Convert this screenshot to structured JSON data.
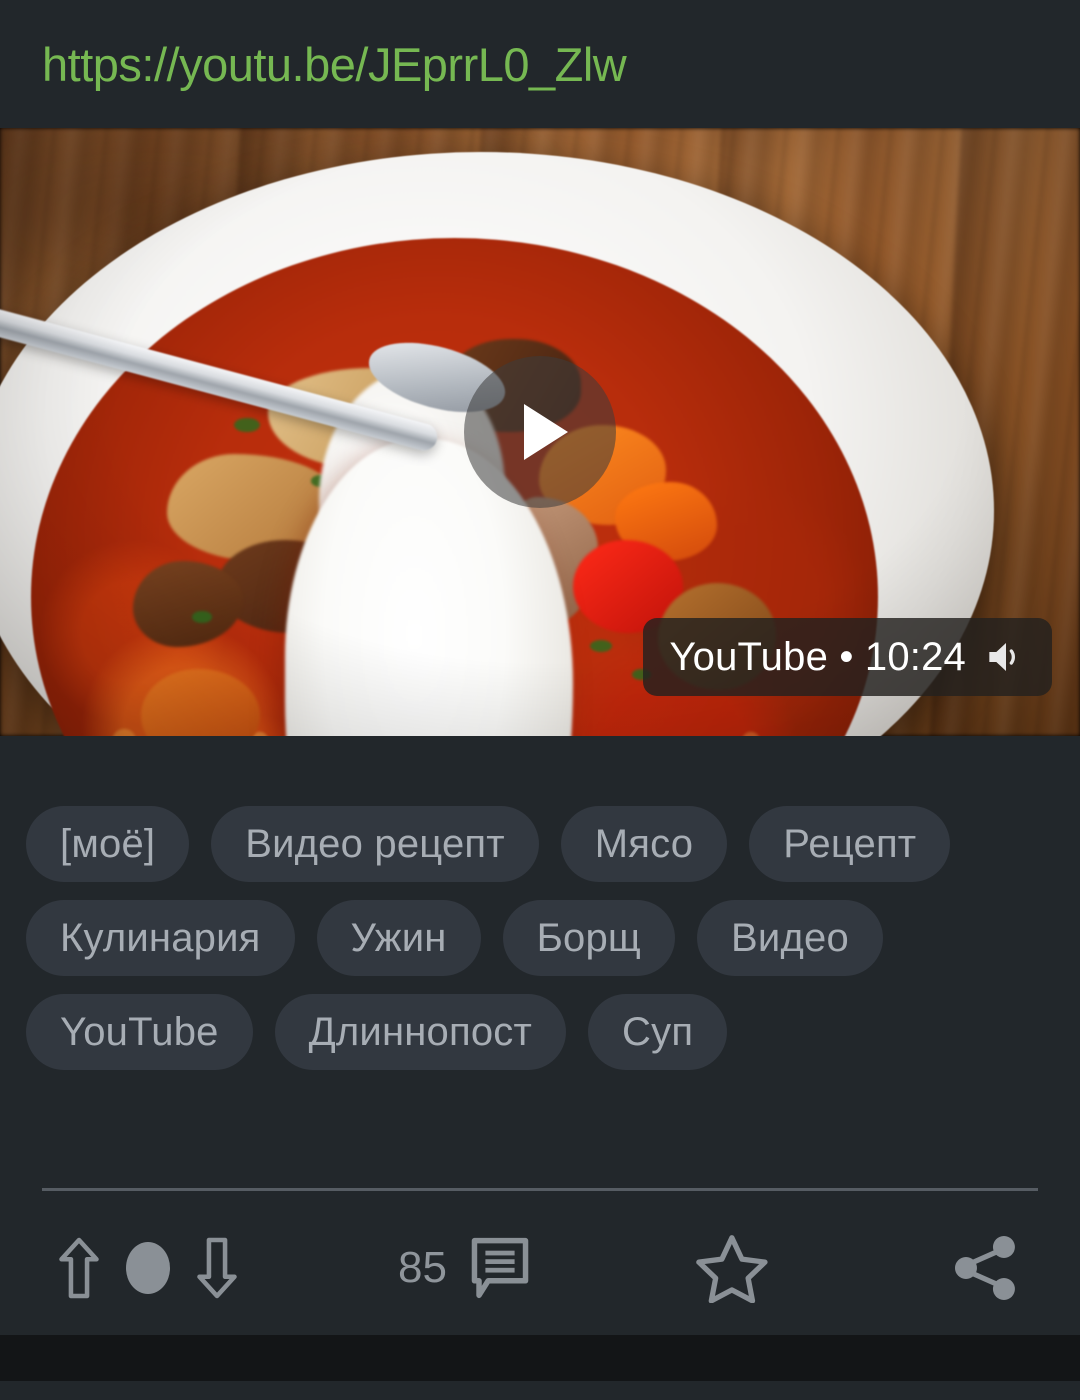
{
  "post": {
    "url": "https://youtu.be/JEprrL0_Zlw",
    "url_color": "#76b852"
  },
  "media": {
    "type": "video-preview",
    "play_icon": "play-icon",
    "badge": {
      "source": "YouTube",
      "separator": "•",
      "duration": "10:24",
      "volume_icon": "volume-icon"
    }
  },
  "tags": [
    {
      "label": "[моё]"
    },
    {
      "label": "Видео рецепт"
    },
    {
      "label": "Мясо"
    },
    {
      "label": "Рецепт"
    },
    {
      "label": "Кулинария"
    },
    {
      "label": "Ужин"
    },
    {
      "label": "Борщ"
    },
    {
      "label": "Видео"
    },
    {
      "label": "YouTube"
    },
    {
      "label": "Длиннопост"
    },
    {
      "label": "Суп"
    }
  ],
  "actions": {
    "upvote_icon": "arrow-up-icon",
    "rating_icon": "rating-dot-icon",
    "downvote_icon": "arrow-down-icon",
    "comment_count": "85",
    "comment_icon": "comment-icon",
    "favorite_icon": "star-icon",
    "share_icon": "share-icon"
  },
  "theme": {
    "page_background": "#1a1c1f",
    "card_background": "#22272b",
    "tag_background": "#323840",
    "tag_text": "#a7adb4",
    "icon_color": "#8a9096",
    "divider": "#565c63"
  }
}
